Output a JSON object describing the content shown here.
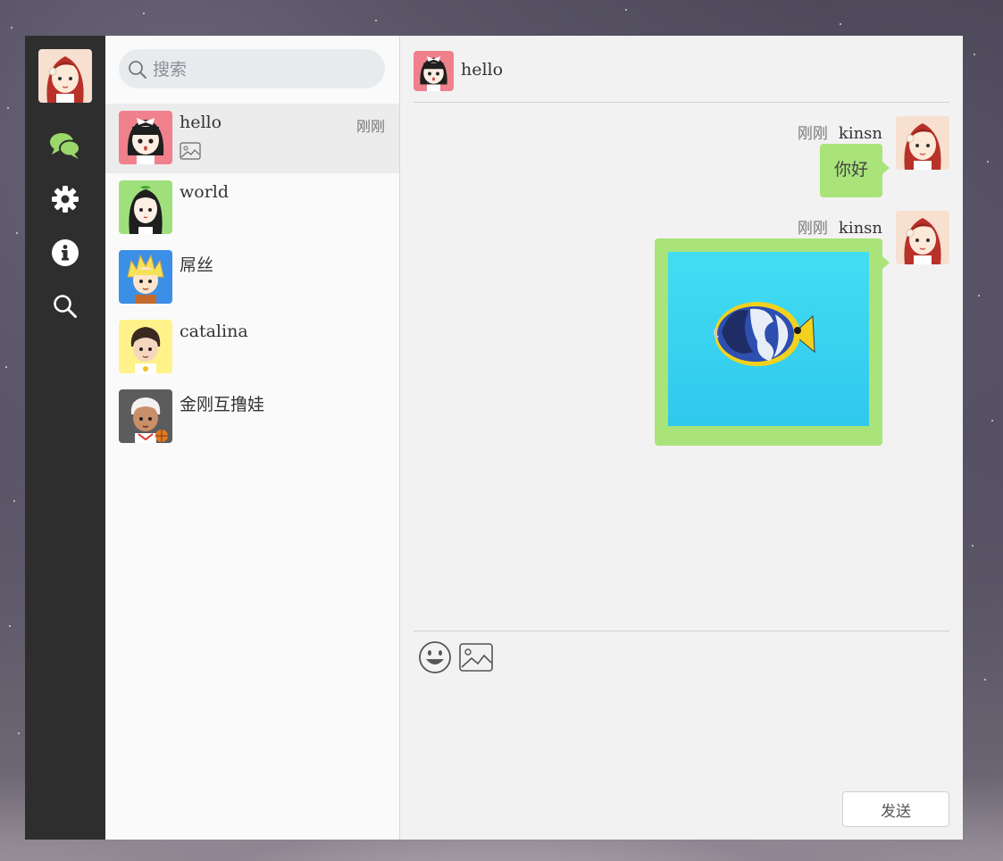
{
  "app": {
    "title": ""
  },
  "colors": {
    "nav_bg": "#2e2e2e",
    "list_bg": "#fafafa",
    "chat_bg": "#f2f2f2",
    "accent": "#9bd86a",
    "bubble": "#a9e37a",
    "active_item": "#ececec"
  },
  "nav": {
    "items": [
      {
        "icon": "chat-bubbles-icon",
        "active": true
      },
      {
        "icon": "gear-icon",
        "active": false
      },
      {
        "icon": "info-icon",
        "active": false
      },
      {
        "icon": "search-icon",
        "active": false
      }
    ]
  },
  "search": {
    "placeholder": "搜索",
    "value": ""
  },
  "sessions": [
    {
      "name": "hello",
      "time": "刚刚",
      "preview_icon": "image-icon",
      "active": true,
      "avatar_bg": "#f0808c"
    },
    {
      "name": "world",
      "time": "",
      "active": false,
      "avatar_bg": "#9fe07d"
    },
    {
      "name": "屌丝",
      "time": "",
      "active": false,
      "avatar_bg": "#3b8fe6"
    },
    {
      "name": "catalina",
      "time": "",
      "active": false,
      "avatar_bg": "#fff28a"
    },
    {
      "name": "金刚互撸娃",
      "time": "",
      "active": false,
      "avatar_bg": "#5c5c5c"
    }
  ],
  "chat": {
    "contact_name": "hello",
    "messages": [
      {
        "time": "刚刚",
        "sender": "kinsn",
        "type": "text",
        "text": "你好"
      },
      {
        "time": "刚刚",
        "sender": "kinsn",
        "type": "image",
        "image": "fish-image"
      }
    ],
    "toolbar": {
      "emoji_icon": "smile-icon",
      "image_icon": "image-icon"
    },
    "input_value": "",
    "send_label": "发送"
  }
}
